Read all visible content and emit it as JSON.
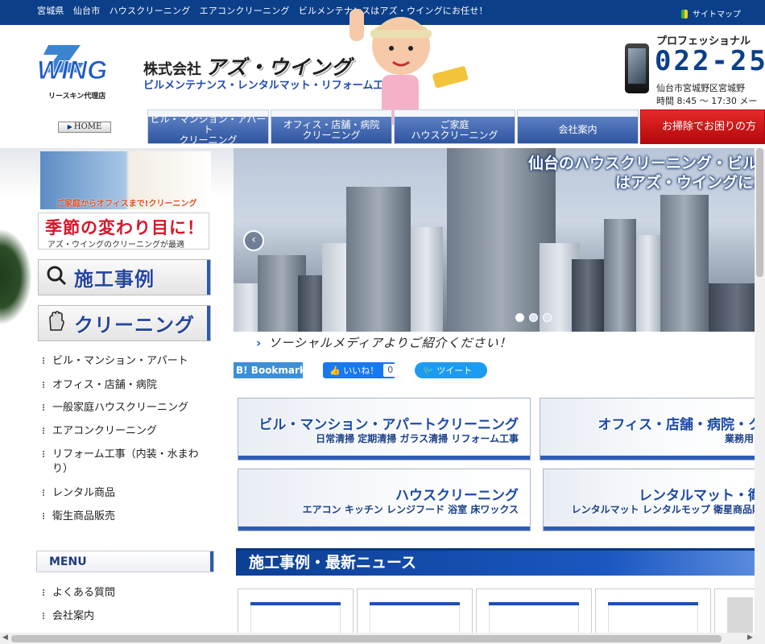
{
  "topbar": {
    "message": "宮城県　仙台市　ハウスクリーニング　エアコンクリーニング　ビルメンテナンスはアズ・ウイングにお任せ！",
    "sitemap_label": "サイトマップ"
  },
  "header": {
    "logo_text": "WING",
    "logo_sub": "リースキン代理店",
    "home_label": "HOME",
    "company_prefix": "株式会社",
    "company_name": "アズ・ウイング",
    "tagline": "ビルメンテナンス・レンタルマット・リフォーム工事",
    "pro_label": "プロフェッショナル",
    "phone": "022-25",
    "address": "仙台市宮城野区宮城野",
    "hours": "時間 8:45 ～ 17:30 メー"
  },
  "nav": {
    "items": [
      {
        "label": "ビル・マンション・アパート\nクリーニング"
      },
      {
        "label": "オフィス・店舗・病院\nクリーニング"
      },
      {
        "label": "ご家庭\nハウスクリーニング"
      },
      {
        "label": "会社案内"
      },
      {
        "label": "お掃除でお困りの方"
      }
    ]
  },
  "sidebar": {
    "banner_caption": "ご家庭からオフィスまで!クリーニング",
    "season_title": "季節の変わり目に！",
    "season_sub": "アズ・ウイングのクリーニングが最適",
    "btn_cases": "施工事例",
    "btn_cleaning": "クリーニング",
    "cleaning_links": [
      "ビル・マンション・アパート",
      "オフィス・店舗・病院",
      "一般家庭ハウスクリーニング",
      "エアコンクリーニング",
      "リフォーム工事（内装・水まわり）",
      "レンタル商品",
      "衛生商品販売"
    ],
    "menu_title": "MENU",
    "menu_links": [
      "よくある質問",
      "会社案内"
    ]
  },
  "hero": {
    "catch_line1": "仙台のハウスクリーニング・ビル",
    "catch_line2": "はアズ・ウイングにお",
    "slide_count": 3,
    "active_slide": 1
  },
  "social": {
    "heading": "ソーシャルメディアよりご紹介ください！",
    "bookmark_label": "B! Bookmark",
    "like_label": "いいね！",
    "like_count": "0",
    "tweet_label": "ツイート"
  },
  "services": [
    {
      "title": "ビル・マンション・アパートクリーニング",
      "sub": "日常清掃 定期清掃 ガラス清掃 リフォーム工事"
    },
    {
      "title": "オフィス・店舗・病院・ク",
      "sub": "業務用"
    },
    {
      "title": "ハウスクリーニング",
      "sub": "エアコン キッチン レンジフード 浴室 床ワックス"
    },
    {
      "title": "レンタルマット・衛",
      "sub": "レンタルマット レンタルモップ 衛星商品販"
    }
  ],
  "news": {
    "heading": "施工事例・最新ニュース"
  },
  "colors": {
    "brand_blue": "#0b3f8a",
    "accent_red": "#d9152a"
  }
}
